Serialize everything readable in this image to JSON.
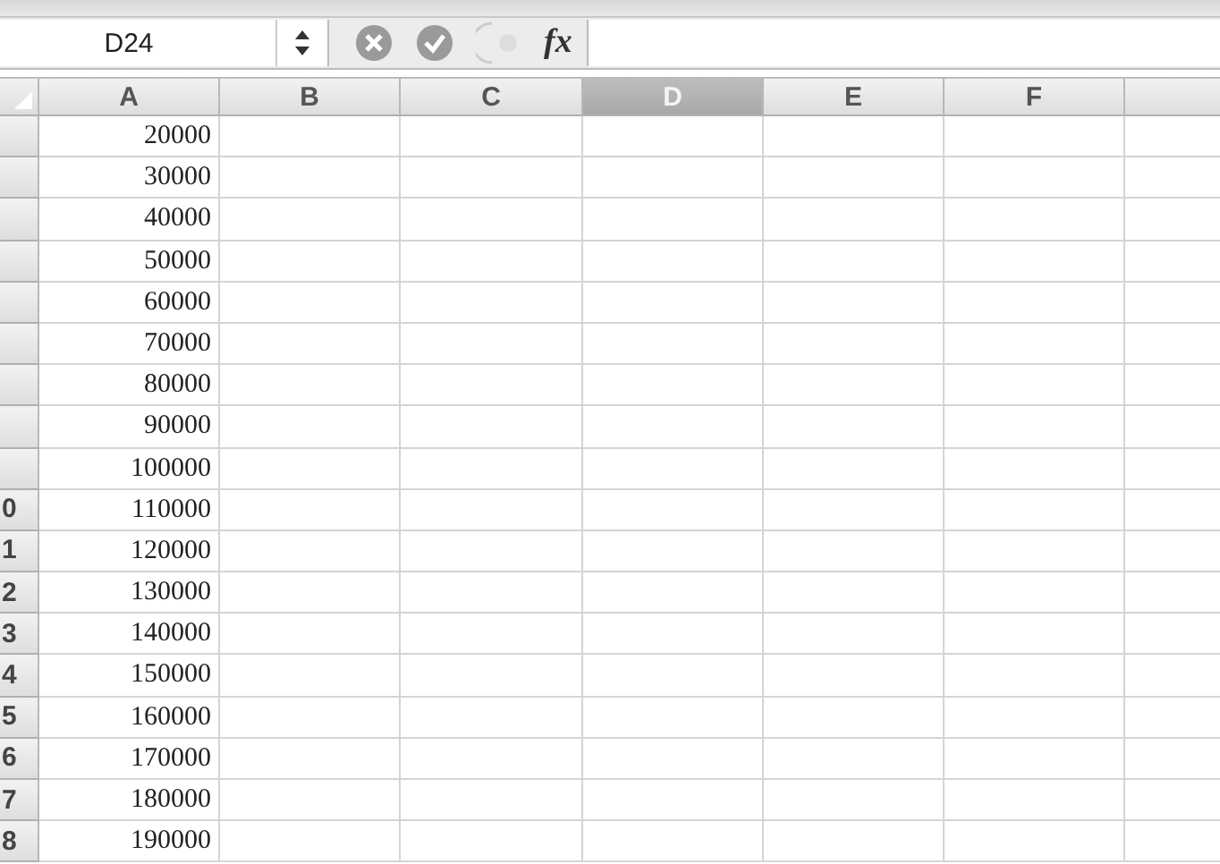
{
  "formula_bar": {
    "name_box": "D24",
    "function_label": "fx"
  },
  "columns": [
    {
      "label": "A",
      "selected": false
    },
    {
      "label": "B",
      "selected": false
    },
    {
      "label": "C",
      "selected": false
    },
    {
      "label": "D",
      "selected": true
    },
    {
      "label": "E",
      "selected": false
    },
    {
      "label": "F",
      "selected": false
    },
    {
      "selected": false
    }
  ],
  "rows": [
    {
      "column_A": "20000"
    },
    {
      "column_A": "30000"
    },
    {
      "column_A": "40000"
    },
    {
      "column_A": "50000"
    },
    {
      "column_A": "60000"
    },
    {
      "column_A": "70000"
    },
    {
      "column_A": "80000"
    },
    {
      "column_A": "90000"
    },
    {
      "column_A": "100000"
    },
    {
      "header": "0",
      "column_A": "110000"
    },
    {
      "header": "1",
      "column_A": "120000"
    },
    {
      "header": "2",
      "column_A": "130000"
    },
    {
      "header": "3",
      "column_A": "140000"
    },
    {
      "header": "4",
      "column_A": "150000"
    },
    {
      "header": "5",
      "column_A": "160000"
    },
    {
      "header": "6",
      "column_A": "170000"
    },
    {
      "header": "7",
      "column_A": "180000"
    },
    {
      "header": "8",
      "column_A": "190000"
    }
  ]
}
